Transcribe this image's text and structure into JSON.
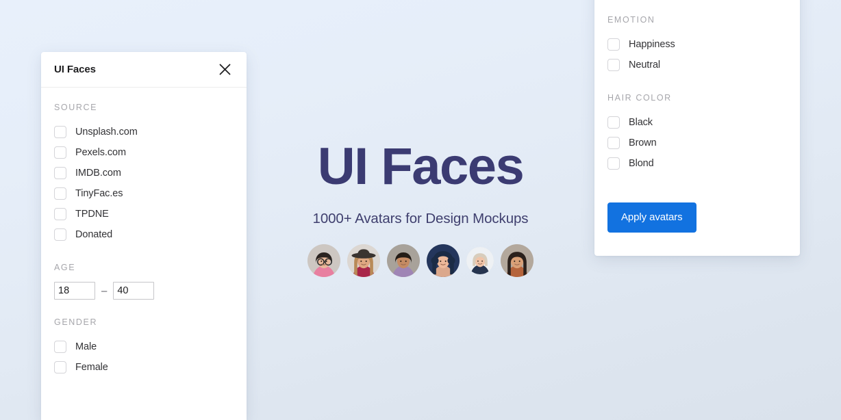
{
  "hero": {
    "title": "UI Faces",
    "subtitle": "1000+ Avatars for Design Mockups",
    "title_color": "#3b3b72",
    "avatars": [
      {
        "name": "avatar-1",
        "size": 48,
        "skin": "#e8b89a",
        "hair": "#2a2320",
        "clothes": "#e87fa0",
        "bg": "#cdc7c2",
        "glasses": true,
        "hair_style": "short"
      },
      {
        "name": "avatar-2",
        "size": 48,
        "skin": "#e0a882",
        "hair": "#b98a57",
        "clothes": "#a8264a",
        "bg": "#dcd7d2",
        "hat": true,
        "hair_style": "long"
      },
      {
        "name": "avatar-3",
        "size": 48,
        "skin": "#c58b63",
        "hair": "#241c16",
        "clothes": "#9f85b5",
        "bg": "#a8a29a",
        "hair_style": "short"
      },
      {
        "name": "avatar-4",
        "size": 48,
        "skin": "#edb99b",
        "hair": "#1b2b45",
        "clothes": "#dba88c",
        "bg": "#24365c",
        "hair_style": "curly"
      },
      {
        "name": "avatar-5",
        "size": 40,
        "skin": "#f0c4a8",
        "hair": "#d8cdbc",
        "clothes": "#26344f",
        "bg": "#eef1f4",
        "hair_style": "bob"
      },
      {
        "name": "avatar-6",
        "size": 48,
        "skin": "#d9a077",
        "hair": "#2b211c",
        "clothes": "#b5643c",
        "bg": "#b3a89c",
        "hair_style": "long"
      }
    ]
  },
  "left_panel": {
    "title": "UI Faces",
    "close_icon": "close-icon",
    "sections": [
      {
        "label": "SOURCE",
        "type": "checkboxes",
        "items": [
          {
            "label": "Unsplash.com",
            "checked": false
          },
          {
            "label": "Pexels.com",
            "checked": false
          },
          {
            "label": "IMDB.com",
            "checked": false
          },
          {
            "label": "TinyFac.es",
            "checked": false
          },
          {
            "label": "TPDNE",
            "checked": false
          },
          {
            "label": "Donated",
            "checked": false
          }
        ]
      },
      {
        "label": "AGE",
        "type": "range",
        "min_value": "18",
        "max_value": "40",
        "separator": "–"
      },
      {
        "label": "GENDER",
        "type": "checkboxes",
        "items": [
          {
            "label": "Male",
            "checked": false
          },
          {
            "label": "Female",
            "checked": false
          }
        ]
      }
    ]
  },
  "right_panel": {
    "sections": [
      {
        "label": "EMOTION",
        "items": [
          {
            "label": "Happiness",
            "checked": false
          },
          {
            "label": "Neutral",
            "checked": false
          }
        ]
      },
      {
        "label": "HAIR COLOR",
        "items": [
          {
            "label": "Black",
            "checked": false
          },
          {
            "label": "Brown",
            "checked": false
          },
          {
            "label": "Blond",
            "checked": false
          }
        ]
      }
    ],
    "apply_button_label": "Apply avatars",
    "apply_button_color": "#1272e0"
  }
}
